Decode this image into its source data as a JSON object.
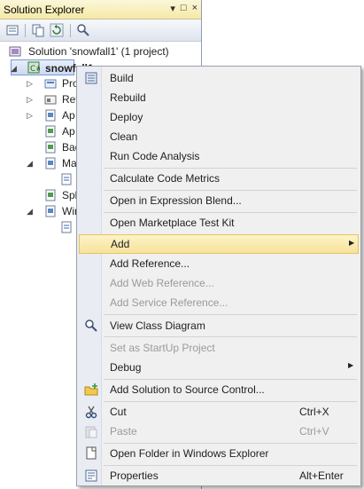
{
  "solution_explorer": {
    "title": "Solution Explorer",
    "title_buttons": [
      "▾",
      "□",
      "×"
    ],
    "solution_label": "Solution 'snowfall1' (1 project)",
    "project_label": "snowfall1",
    "tree_items": [
      {
        "label": "Pro",
        "expandable": true
      },
      {
        "label": "Ref",
        "expandable": true
      },
      {
        "label": "Ap",
        "expandable": true
      },
      {
        "label": "Ap",
        "expandable": false
      },
      {
        "label": "Bac",
        "expandable": false
      },
      {
        "label": "Ma",
        "expandable": true,
        "expanded": true
      },
      {
        "label": "",
        "child": true
      },
      {
        "label": "Spl",
        "expandable": false
      },
      {
        "label": "Win",
        "expandable": true,
        "expanded": true
      },
      {
        "label": "",
        "child": true
      }
    ]
  },
  "context_menu": {
    "items": [
      {
        "label": "Build",
        "icon": "build-icon"
      },
      {
        "label": "Rebuild"
      },
      {
        "label": "Deploy"
      },
      {
        "label": "Clean"
      },
      {
        "label": "Run Code Analysis"
      },
      {
        "label": "Calculate Code Metrics"
      },
      {
        "label": "Open in Expression Blend..."
      },
      {
        "label": "Open Marketplace Test Kit"
      },
      {
        "label": "Add",
        "submenu": "▶"
      },
      {
        "label": "Add Reference..."
      },
      {
        "label": "Add Web Reference..."
      },
      {
        "label": "Add Service Reference..."
      },
      {
        "label": "View Class Diagram",
        "icon": "class-diagram-icon"
      },
      {
        "label": "Set as StartUp Project"
      },
      {
        "label": "Debug",
        "submenu": "▶"
      },
      {
        "label": "Add Solution to Source Control...",
        "icon": "source-control-icon"
      },
      {
        "label": "Cut",
        "shortcut": "Ctrl+X",
        "icon": "cut-icon"
      },
      {
        "label": "Paste",
        "shortcut": "Ctrl+V",
        "icon": "paste-icon"
      },
      {
        "label": "Open Folder in Windows Explorer",
        "icon": "folder-open-icon"
      },
      {
        "label": "Properties",
        "shortcut": "Alt+Enter",
        "icon": "properties-icon"
      }
    ]
  },
  "colors": {
    "title_bar": "#f5e9a5",
    "menu_bg": "#f0f0f0",
    "highlight": "#f8e29a",
    "disabled_text": "#9a9a9a"
  }
}
